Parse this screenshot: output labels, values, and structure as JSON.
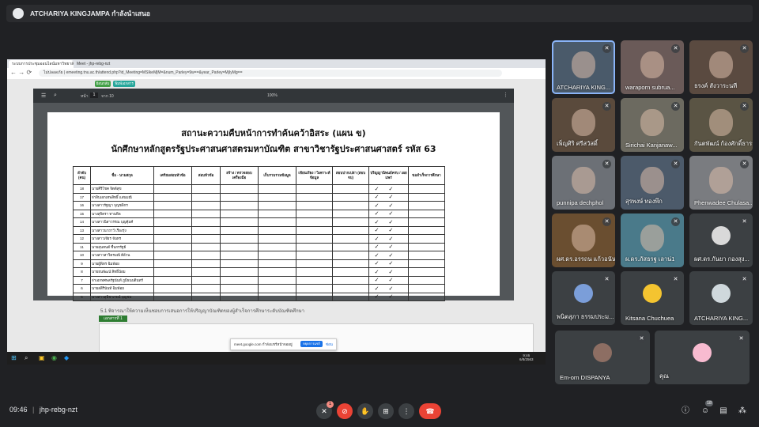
{
  "presenter": {
    "label": "ATCHARIYA KINGJAMPA กำลังนำเสนอ"
  },
  "browser": {
    "tabs": [
      "ระบบการประชุมออนไลน์มหาวิทยาลัย",
      "Meet - jhp-rebg-nzt"
    ],
    "url": "ไม่ปลอดภัย | emeeting.tnu.ac.th/attend.php?id_Meeting=MSIkeMjM=&num_Parley=9w==&year_Parley=MjIyMg=="
  },
  "page_buttons": [
    "ย้อนกลับ",
    "พิมพ์เอกสาร"
  ],
  "pdf": {
    "page_label": "หน้า",
    "page_value": "1",
    "page_total": "จาก 10",
    "zoom": "100%",
    "title1": "สถานะความคืบหน้าการทำค้นคว้าอิสระ (แผน ข)",
    "title2": "นักศึกษาหลักสูตรรัฐประศาสนศาสตรมหาบัณฑิต สาขาวิชารัฐประศาสนศาสตร์ รหัส 63",
    "headers": [
      "ลำดับ (คน)",
      "ชื่อ - นามสกุล",
      "เตรียมสอบหัวข้อ",
      "สอบหัวข้อ",
      "สร้าง / ตรวจสอบ เครื่องมือ",
      "เก็บรวบรวมข้อมูล",
      "เขียนเรียง / วิเคราะห์ ข้อมูล",
      "สอบปากเปล่า (สอบจบ)",
      "ปริญญานิพนธ์ครบ / เผยแพร่",
      "ขอสำเร็จการศึกษา"
    ],
    "rows": [
      {
        "no": "18",
        "name": "นายศิริโชค จิตต์สุข"
      },
      {
        "no": "17",
        "name": "จ่าสิบเอกเทพสิทธิ์ แสนมณี"
      },
      {
        "no": "16",
        "name": "นางสาวรัฐญา บุญชลิกร"
      },
      {
        "no": "15",
        "name": "นางสุจิตรา ทานทิล"
      },
      {
        "no": "14",
        "name": "นางสาวนิสาวรรณ บุญคุ้มศ์"
      },
      {
        "no": "13",
        "name": "นางสาวนาถาวี เรืองรุ่ง"
      },
      {
        "no": "12",
        "name": "นางสาวเจียร จันทร"
      },
      {
        "no": "11",
        "name": "นายสุนทนต์ ชื่นกรรัฐธี"
      },
      {
        "no": "10",
        "name": "นางสาวสาวิตรมณี ดีอ้วน"
      },
      {
        "no": "9",
        "name": "นายผู้พิทร ฉิมพ้อย"
      },
      {
        "no": "8",
        "name": "นายธนพัฒน์ สิทธิ์น้อม"
      },
      {
        "no": "7",
        "name": "จ่าเอกทศพลรัฐนันท์ ภูมิธนบดินทร์"
      },
      {
        "no": "6",
        "name": "นายสสิรินันท์ ฉิมพ้อย"
      },
      {
        "no": "5",
        "name": "นางสาวสุพิชาภรณ์ บุญชม"
      }
    ],
    "check_mark": "✓"
  },
  "below": {
    "text": "5.1 พิจารณาให้ความเห็นชอบการเสนอการให้ปริญญาบัณฑิตของผู้สำเร็จการศึกษาระดับบัณฑิตศึกษา",
    "tag": "เอกสารที่ 1",
    "sharing_text": "meet.google.com กำลังแชร์หน้าจออยู่",
    "stop_share": "หยุดการแชร์",
    "hide": "ซ่อน",
    "taskbar_time": "9:46",
    "taskbar_date": "6/8/2563"
  },
  "participants": [
    {
      "name": "ATCHARIYA KING..."
    },
    {
      "name": "waraporn subrua..."
    },
    {
      "name": "ธรงค์ สังวาระนที"
    },
    {
      "name": "เพ็ญศิริ ศรีสวัสดิ์"
    },
    {
      "name": "Sirichai Kanjanaw..."
    },
    {
      "name": "กันตพัฒน์ ก้องศักดิ์ธารา"
    },
    {
      "name": "punnipa dechphol"
    },
    {
      "name": "สุรพงษ์ ทองพึก"
    },
    {
      "name": "Phenwadee Chulasa..."
    },
    {
      "name": "ผศ.ดร.อรรถน แก้วอนันต์"
    },
    {
      "name": "ผ.ดร.ภัสธรฐ เลาน่1"
    },
    {
      "name": "ผศ.ดร.กันยา กองสุง..."
    },
    {
      "name": "พนิตสุภา ธรรมประม..."
    },
    {
      "name": "Kitsana Chuchuea"
    },
    {
      "name": "ATCHARIYA KING..."
    },
    {
      "name": "Em-orn DISPANYA"
    },
    {
      "name": "คุณ"
    }
  ],
  "meeting": {
    "time": "09:46",
    "code": "jhp-rebg-nzt",
    "raise_badge": "1",
    "people_count": "18"
  },
  "colors": {
    "accent": "#8ab4f8",
    "danger": "#ea4335",
    "bg": "#202124"
  }
}
